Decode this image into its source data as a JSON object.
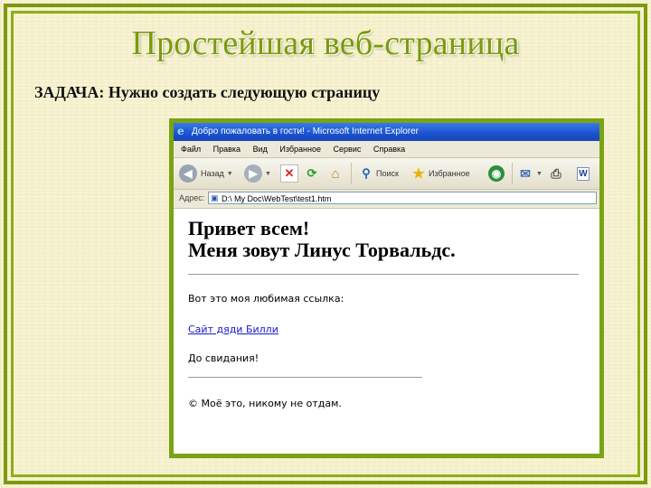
{
  "slide": {
    "title": "Простейшая веб-страница",
    "task": "ЗАДАЧА: Нужно создать следующую страницу"
  },
  "browser": {
    "window_title": "Добро пожаловать в гости! - Microsoft Internet Explorer",
    "menu": [
      "Файл",
      "Правка",
      "Вид",
      "Избранное",
      "Сервис",
      "Справка"
    ],
    "toolbar": {
      "back_label": "Назад",
      "search_label": "Поиск",
      "favorites_label": "Избранное"
    },
    "address": {
      "label": "Адрес:",
      "value": "D:\\ My Doc\\WebTest\\test1.htm"
    },
    "page": {
      "heading_line1": "Привет всем!",
      "heading_line2": "Меня зовут Линус Торвальдс.",
      "link_intro": "Вот это моя любимая ссылка:",
      "link_text": "Сайт дяди Билли",
      "goodbye": "До свидания!",
      "copyright": "© Моё это, никому не отдам."
    }
  },
  "colors": {
    "frame_green": "#7c9a10",
    "title_green": "#7b9a10",
    "link_blue": "#1a1ac8",
    "titlebar_blue": "#1a52cf"
  }
}
